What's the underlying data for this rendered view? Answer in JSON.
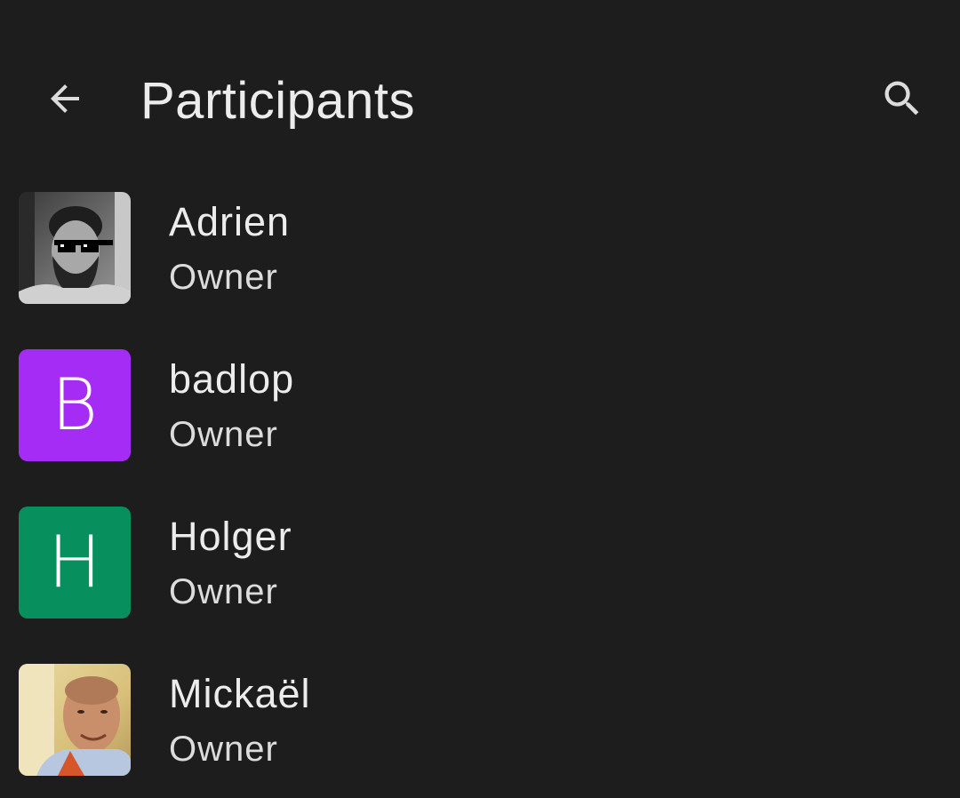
{
  "header": {
    "title": "Participants",
    "back_icon": "arrow-left-icon",
    "search_icon": "search-icon"
  },
  "participants": [
    {
      "name": "Adrien",
      "role": "Owner",
      "avatar_type": "photo",
      "avatar_desc": "bearded-man-pixel-sunglasses-photo"
    },
    {
      "name": "badlop",
      "role": "Owner",
      "avatar_type": "letter",
      "avatar_letter": "B",
      "avatar_color": "#a52cf5"
    },
    {
      "name": "Holger",
      "role": "Owner",
      "avatar_type": "letter",
      "avatar_letter": "H",
      "avatar_color": "#078f5d"
    },
    {
      "name": "Mickaël",
      "role": "Owner",
      "avatar_type": "photo",
      "avatar_desc": "smiling-man-photo"
    }
  ],
  "colors": {
    "background": "#1c1d1c",
    "text_primary": "#ececec",
    "text_secondary": "#dcdcdc"
  }
}
